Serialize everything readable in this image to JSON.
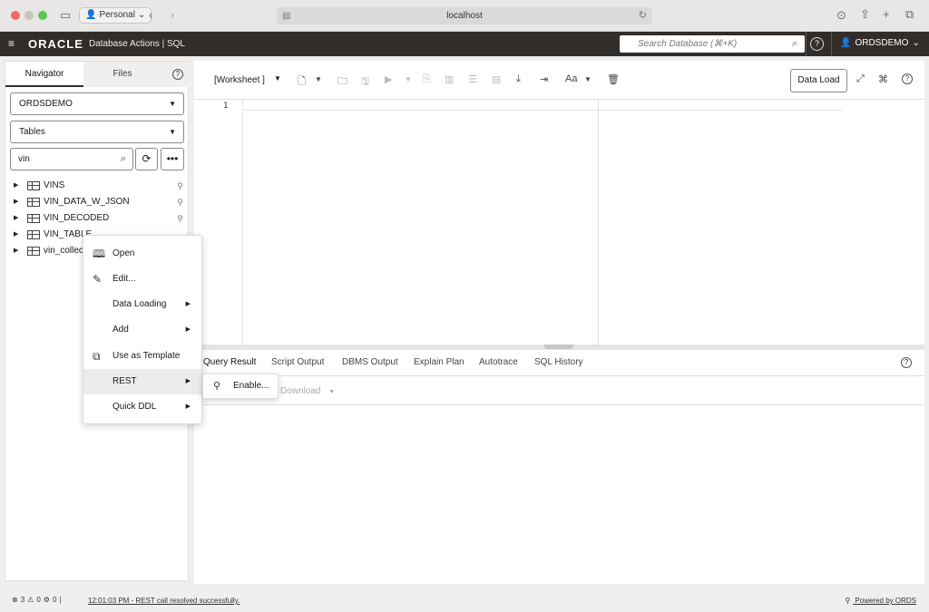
{
  "browser": {
    "profile": "Personal",
    "url": "localhost"
  },
  "header": {
    "logo": "ORACLE",
    "title": "Database Actions | SQL",
    "search_placeholder": "Search Database (⌘+K)",
    "help": "?",
    "user": "ORDSDEMO"
  },
  "navigator": {
    "tabs": [
      "Navigator",
      "Files"
    ],
    "help": "?",
    "schema": "ORDSDEMO",
    "object_type": "Tables",
    "filter": "vin",
    "tables": [
      {
        "name": "VINS"
      },
      {
        "name": "VIN_DATA_W_JSON"
      },
      {
        "name": "VIN_DECODED"
      },
      {
        "name": "VIN_TABLE"
      },
      {
        "name": "vin_collec"
      }
    ]
  },
  "worksheet": {
    "name": "[Worksheet ]",
    "data_load": "Data Load",
    "line_number": "1",
    "help": "?"
  },
  "results": {
    "tabs": [
      "Query Result",
      "Script Output",
      "DBMS Output",
      "Explain Plan",
      "Autotrace",
      "SQL History"
    ],
    "download": "Download",
    "help": "?"
  },
  "context_menu": {
    "items": [
      "Open",
      "Edit...",
      "Data Loading",
      "Add",
      "Use as Template",
      "REST",
      "Quick DDL"
    ],
    "submenu_item": "Enable..."
  },
  "status": {
    "errors": "3",
    "warnings": "0",
    "jobs": "0",
    "message": "12:01:03 PM - REST call resolved successfully.",
    "powered_by": "Powered by ORDS"
  }
}
